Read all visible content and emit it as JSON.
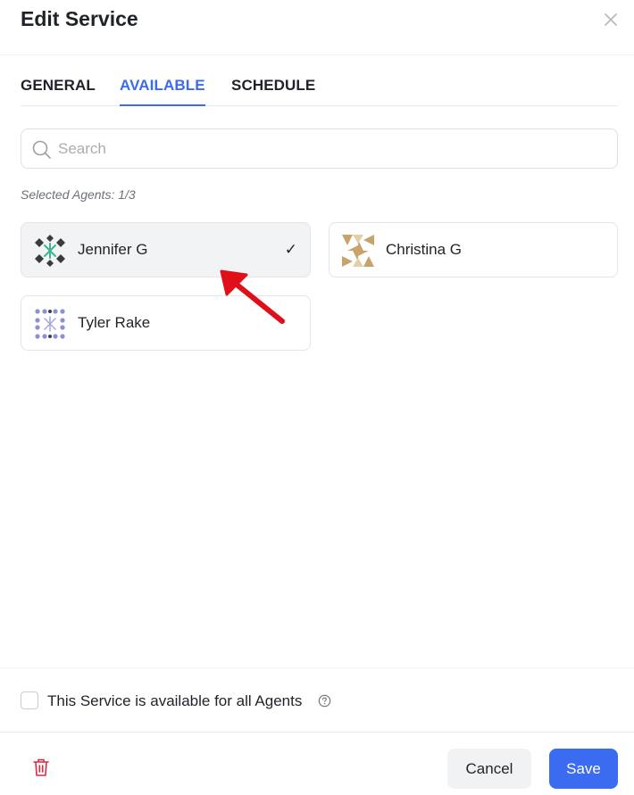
{
  "dialog": {
    "title": "Edit Service"
  },
  "tabs": [
    {
      "label": "GENERAL",
      "active": false
    },
    {
      "label": "AVAILABLE",
      "active": true
    },
    {
      "label": "SCHEDULE",
      "active": false
    }
  ],
  "search": {
    "placeholder": "Search",
    "value": ""
  },
  "selected_info": "Selected Agents: 1/3",
  "agents": [
    {
      "name": "Jennifer G",
      "selected": true,
      "check": "✓"
    },
    {
      "name": "Christina G",
      "selected": false
    },
    {
      "name": "Tyler Rake",
      "selected": false
    }
  ],
  "footer": {
    "all_agents_label": "This Service is available for all Agents",
    "all_agents_checked": false,
    "cancel_label": "Cancel",
    "save_label": "Save"
  },
  "colors": {
    "accent": "#3a6bf0",
    "danger": "#e0263d",
    "annotation": "#e0101a"
  }
}
